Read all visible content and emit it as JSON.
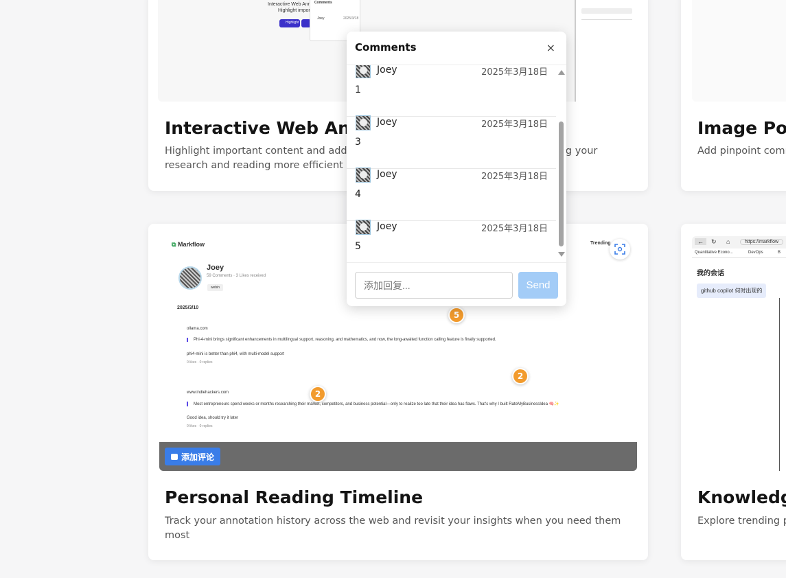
{
  "cards": {
    "annotation": {
      "title": "Interactive Web Annotation",
      "desc": "Highlight important content and add comments directly on any webpage, making your research and reading more efficient",
      "mini": {
        "line1": "Interactive Web Annotation · Comments",
        "line2": "Highlight important content",
        "btn": "Highlight",
        "side_title": "Comments",
        "side_name": "Joey",
        "side_date": "2025/3/18"
      }
    },
    "image_point": {
      "title": "Image Pointer Comments",
      "desc": "Add pinpoint comments on images for precise and collaborative discussions"
    },
    "timeline": {
      "title": "Personal Reading Timeline",
      "desc": "Track your annotation history across the web and revisit your insights when you need them most",
      "mini": {
        "brand": "Markflow",
        "trending": "Trending",
        "user": "Joey",
        "stats": "59 Comments · 3 Likes received",
        "tag": "webin",
        "date": "2025/3/10",
        "entries": [
          {
            "site": "ollama.com",
            "quote": "Phi-4-mini brings significant enhancements in multilingual support, reasoning, and mathematics, and now, the long-awaited function calling feature is finally supported.",
            "note": "phi4-mini is better than phi4, with multi-model support",
            "meta": "0 likes · 0 replies"
          },
          {
            "site": "www.indiehackers.com",
            "quote": "Most entrepreneurs spend weeks or months researching their market, competitors, and business potential—only to realize too late that their idea has flaws. That's why I built RateMyBusinessIdea 🧠✨",
            "note": "Good idea, should try it later",
            "meta": "0 likes · 0 replies"
          }
        ],
        "add_comment": "添加评论"
      },
      "badges": [
        "5",
        "2",
        "2"
      ]
    },
    "knowledge": {
      "title": "Knowledge Discovery",
      "desc": "Explore trending pages and discussions in your language",
      "mini": {
        "url": "https://markflow",
        "bookmark1": "Quantitative Econo...",
        "bookmark2": "DevOps",
        "bookmark3": "B",
        "heading": "我的会话",
        "chip": "github copilot 何时出现的"
      }
    }
  },
  "popup": {
    "title": "Comments",
    "close": "×",
    "comments": [
      {
        "name": "Joey",
        "date": "2025年3月18日",
        "text": "1"
      },
      {
        "name": "Joey",
        "date": "2025年3月18日",
        "text": "3"
      },
      {
        "name": "Joey",
        "date": "2025年3月18日",
        "text": "4"
      },
      {
        "name": "Joey",
        "date": "2025年3月18日",
        "text": "5"
      }
    ],
    "reply_placeholder": "添加回复...",
    "send": "Send"
  }
}
